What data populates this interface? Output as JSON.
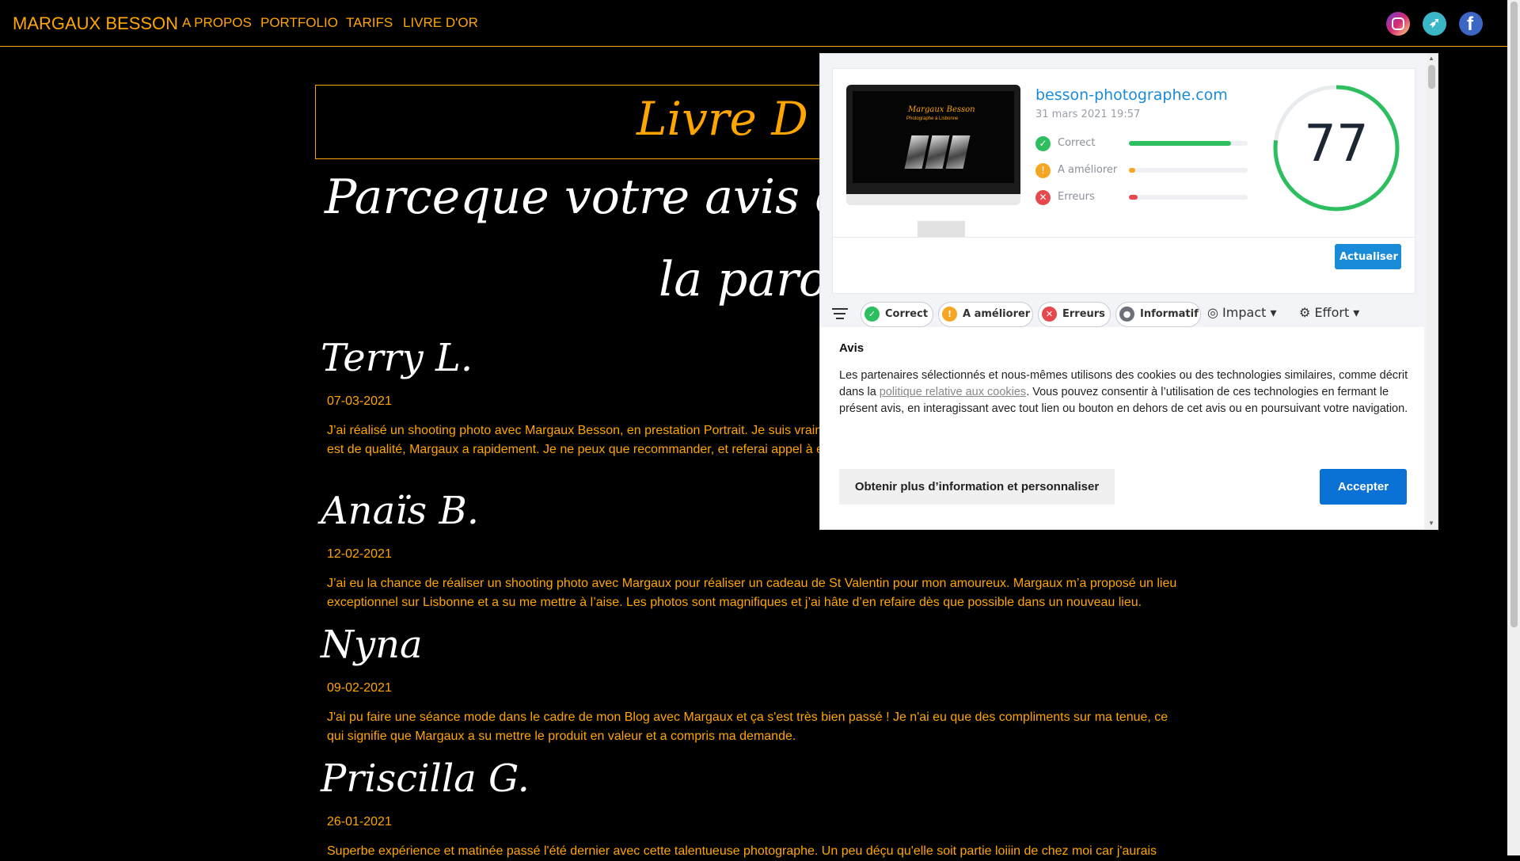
{
  "nav": {
    "brand": "MARGAUX BESSON",
    "items": [
      "A PROPOS",
      "PORTFOLIO",
      "TARIFS",
      "LIVRE D'OR"
    ],
    "social": {
      "instagram": {
        "icon": "instagram-icon"
      },
      "twitter": {
        "icon": "twitter-icon"
      },
      "facebook": {
        "icon": "facebook-icon",
        "glyph": "f"
      }
    }
  },
  "page": {
    "title": "Livre D",
    "tagline_line1": "Parceque votre avis compte,",
    "tagline_line2": "la parole"
  },
  "reviews": [
    {
      "name": "Terry L.",
      "date": "07-03-2021",
      "text": "J’ai réalisé un shooting photo avec Margaux Besson, en prestation Portrait. Je suis vraim comprendre mes attentes et surtout à les surpasser. Le travail est de qualité, Margaux a rapidement. Je ne peux que recommander, et referai appel à elle tres rapidement !"
    },
    {
      "name": "Anaïs B.",
      "date": "12-02-2021",
      "text": "J’ai eu la chance de réaliser un shooting photo avec Margaux pour réaliser un cadeau de St Valentin pour mon amoureux. Margaux m’a proposé un lieu exceptionnel sur Lisbonne et a su me mettre à l’aise. Les photos sont magnifiques et j’ai hâte d’en refaire dès que possible dans un nouveau lieu."
    },
    {
      "name": "Nyna",
      "date": "09-02-2021",
      "text": "J'ai pu faire une séance mode dans le cadre de mon Blog avec Margaux et ça s'est très bien passé ! Je n'ai eu que des compliments sur ma tenue, ce qui signifie que Margaux a su mettre le produit en valeur et a compris ma demande."
    },
    {
      "name": "Priscilla G.",
      "date": "26-01-2021",
      "text": "Superbe expérience et matinée passé l'été dernier avec cette talentueuse photographe. Un peu déçu qu'elle soit partie loiiin de chez moi car j'aurais"
    }
  ],
  "extension": {
    "preview": {
      "mini_title": "Margaux Besson",
      "mini_sub": "Photographe à Lisbonne"
    },
    "domain": "besson-photographe.com",
    "date": "31 mars 2021 19:57",
    "stats": [
      {
        "label": "Correct",
        "symbol": "✓",
        "color": "#2dbe60",
        "level": 0.86
      },
      {
        "label": "A améliorer",
        "symbol": "!",
        "color": "#f5a623",
        "level": 0.05
      },
      {
        "label": "Erreurs",
        "symbol": "✕",
        "color": "#e5484d",
        "level": 0.07
      }
    ],
    "score": "77",
    "score_value": 77,
    "score_color": "#2dbe60",
    "refresh_label": "Actualiser",
    "filters": [
      {
        "label": "Correct",
        "symbol": "✓",
        "color": "#2dbe60"
      },
      {
        "label": "A améliorer",
        "symbol": "!",
        "color": "#f5a623"
      },
      {
        "label": "Erreurs",
        "symbol": "✕",
        "color": "#e5484d"
      },
      {
        "label": "Informatif",
        "symbol": "●",
        "color": "#6b7079"
      }
    ],
    "impact_label": "Impact",
    "effort_label": "Effort"
  },
  "cookie": {
    "title": "Avis",
    "text_before": "Les partenaires sélectionnés et nous-mêmes utilisons des cookies ou des technologies similaires, comme décrit dans la ",
    "link": "politique relative aux cookies",
    "text_after": ". Vous pouvez consentir à l’utilisation de ces technologies en fermant le présent avis, en interagissant avec tout lien ou bouton en dehors de cet avis ou en poursuivant votre navigation.",
    "more_button": "Obtenir plus d’information et personnaliser",
    "accept_button": "Accepter"
  },
  "colors": {
    "accent": "#ffa500",
    "background": "#000000",
    "link_blue": "#1a8bd9",
    "accept_blue": "#0a72d6"
  }
}
